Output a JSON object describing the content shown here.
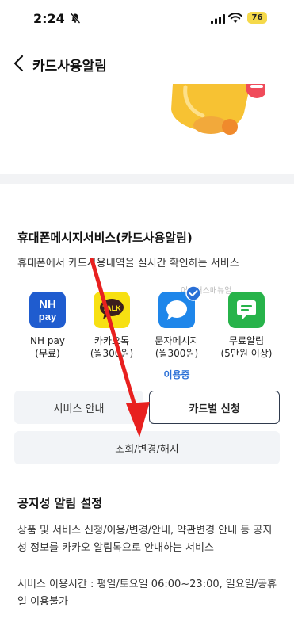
{
  "status_bar": {
    "time": "2:24",
    "battery": "76"
  },
  "header": {
    "title": "카드사용알림"
  },
  "service_section": {
    "title": "휴대폰메시지서비스(카드사용알림)",
    "description": "휴대폰에서 카드사용내역을 실시간 확인하는 서비스",
    "watermark": "어베어스매뉴얼",
    "services": [
      {
        "name": "NH pay",
        "sub": "(무료)",
        "logo_text": "NH\npay",
        "color": "#1f5ccf",
        "status": ""
      },
      {
        "name": "카카오톡",
        "sub": "(월300원)",
        "logo_text": "TALK",
        "color": "#f7e012",
        "status": ""
      },
      {
        "name": "문자메시지",
        "sub": "(월300원)",
        "logo_text": "",
        "color": "#1e86ea",
        "status": "이용중"
      },
      {
        "name": "무료알림",
        "sub": "(5만원 이상)",
        "logo_text": "",
        "color": "#27b34a",
        "status": ""
      }
    ]
  },
  "buttons": {
    "service_guide": "서비스 안내",
    "card_apply": "카드별 신청",
    "inquiry_change": "조회/변경/해지"
  },
  "notice_section": {
    "title": "공지성 알림 설정",
    "desc1": "상품 및 서비스 신청/이용/변경/안내, 약관변경 안내 등 공지성 정보를 카카오 알림톡으로 안내하는 서비스",
    "desc2": "서비스 이용시간 : 평일/토요일 06:00~23:00, 일요일/공휴일 이용불가"
  },
  "colors": {
    "accent": "#2a6fd6",
    "arrow": "#e8201f"
  }
}
